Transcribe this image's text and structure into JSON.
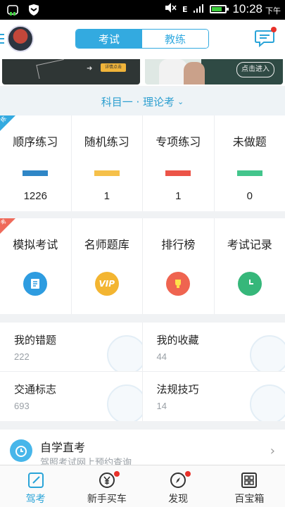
{
  "status_bar": {
    "time": "10:28",
    "ampm": "下午",
    "network": "E"
  },
  "header": {
    "tabs": [
      {
        "label": "考试",
        "active": true
      },
      {
        "label": "教练",
        "active": false
      }
    ]
  },
  "banner": {
    "chip_label": "详情点击",
    "right_text": "点击进入"
  },
  "subject": {
    "label": "科目一 · 理论考"
  },
  "practice": {
    "badge": "练",
    "items": [
      {
        "label": "顺序练习",
        "count": "1226",
        "color": "#2f86c6"
      },
      {
        "label": "随机练习",
        "count": "1",
        "color": "#f5c04a"
      },
      {
        "label": "专项练习",
        "count": "1",
        "color": "#ec5448"
      },
      {
        "label": "未做题",
        "count": "0",
        "color": "#43c58c"
      }
    ]
  },
  "exam": {
    "badge": "考",
    "items": [
      {
        "label": "模拟考试",
        "icon": "exam-paper-icon",
        "color": "#2e9ce0"
      },
      {
        "label": "名师题库",
        "icon": "vip-icon",
        "color": "#f3b531",
        "icon_text": "VIP"
      },
      {
        "label": "排行榜",
        "icon": "trophy-icon",
        "color": "#ef6450"
      },
      {
        "label": "考试记录",
        "icon": "clock-icon",
        "color": "#36b77a"
      }
    ]
  },
  "tiles": [
    {
      "label": "我的错题",
      "count": "222"
    },
    {
      "label": "我的收藏",
      "count": "44"
    },
    {
      "label": "交通标志",
      "count": "693"
    },
    {
      "label": "法规技巧",
      "count": "14"
    }
  ],
  "self_study": {
    "title": "自学直考",
    "subtitle": "驾照考试网上预约查询"
  },
  "tabbar": [
    {
      "label": "驾考",
      "icon": "edit-icon",
      "active": true,
      "dot": false
    },
    {
      "label": "新手买车",
      "icon": "yen-icon",
      "active": false,
      "dot": true
    },
    {
      "label": "发现",
      "icon": "compass-icon",
      "active": false,
      "dot": true
    },
    {
      "label": "百宝箱",
      "icon": "grid-icon",
      "active": false,
      "dot": false
    }
  ]
}
